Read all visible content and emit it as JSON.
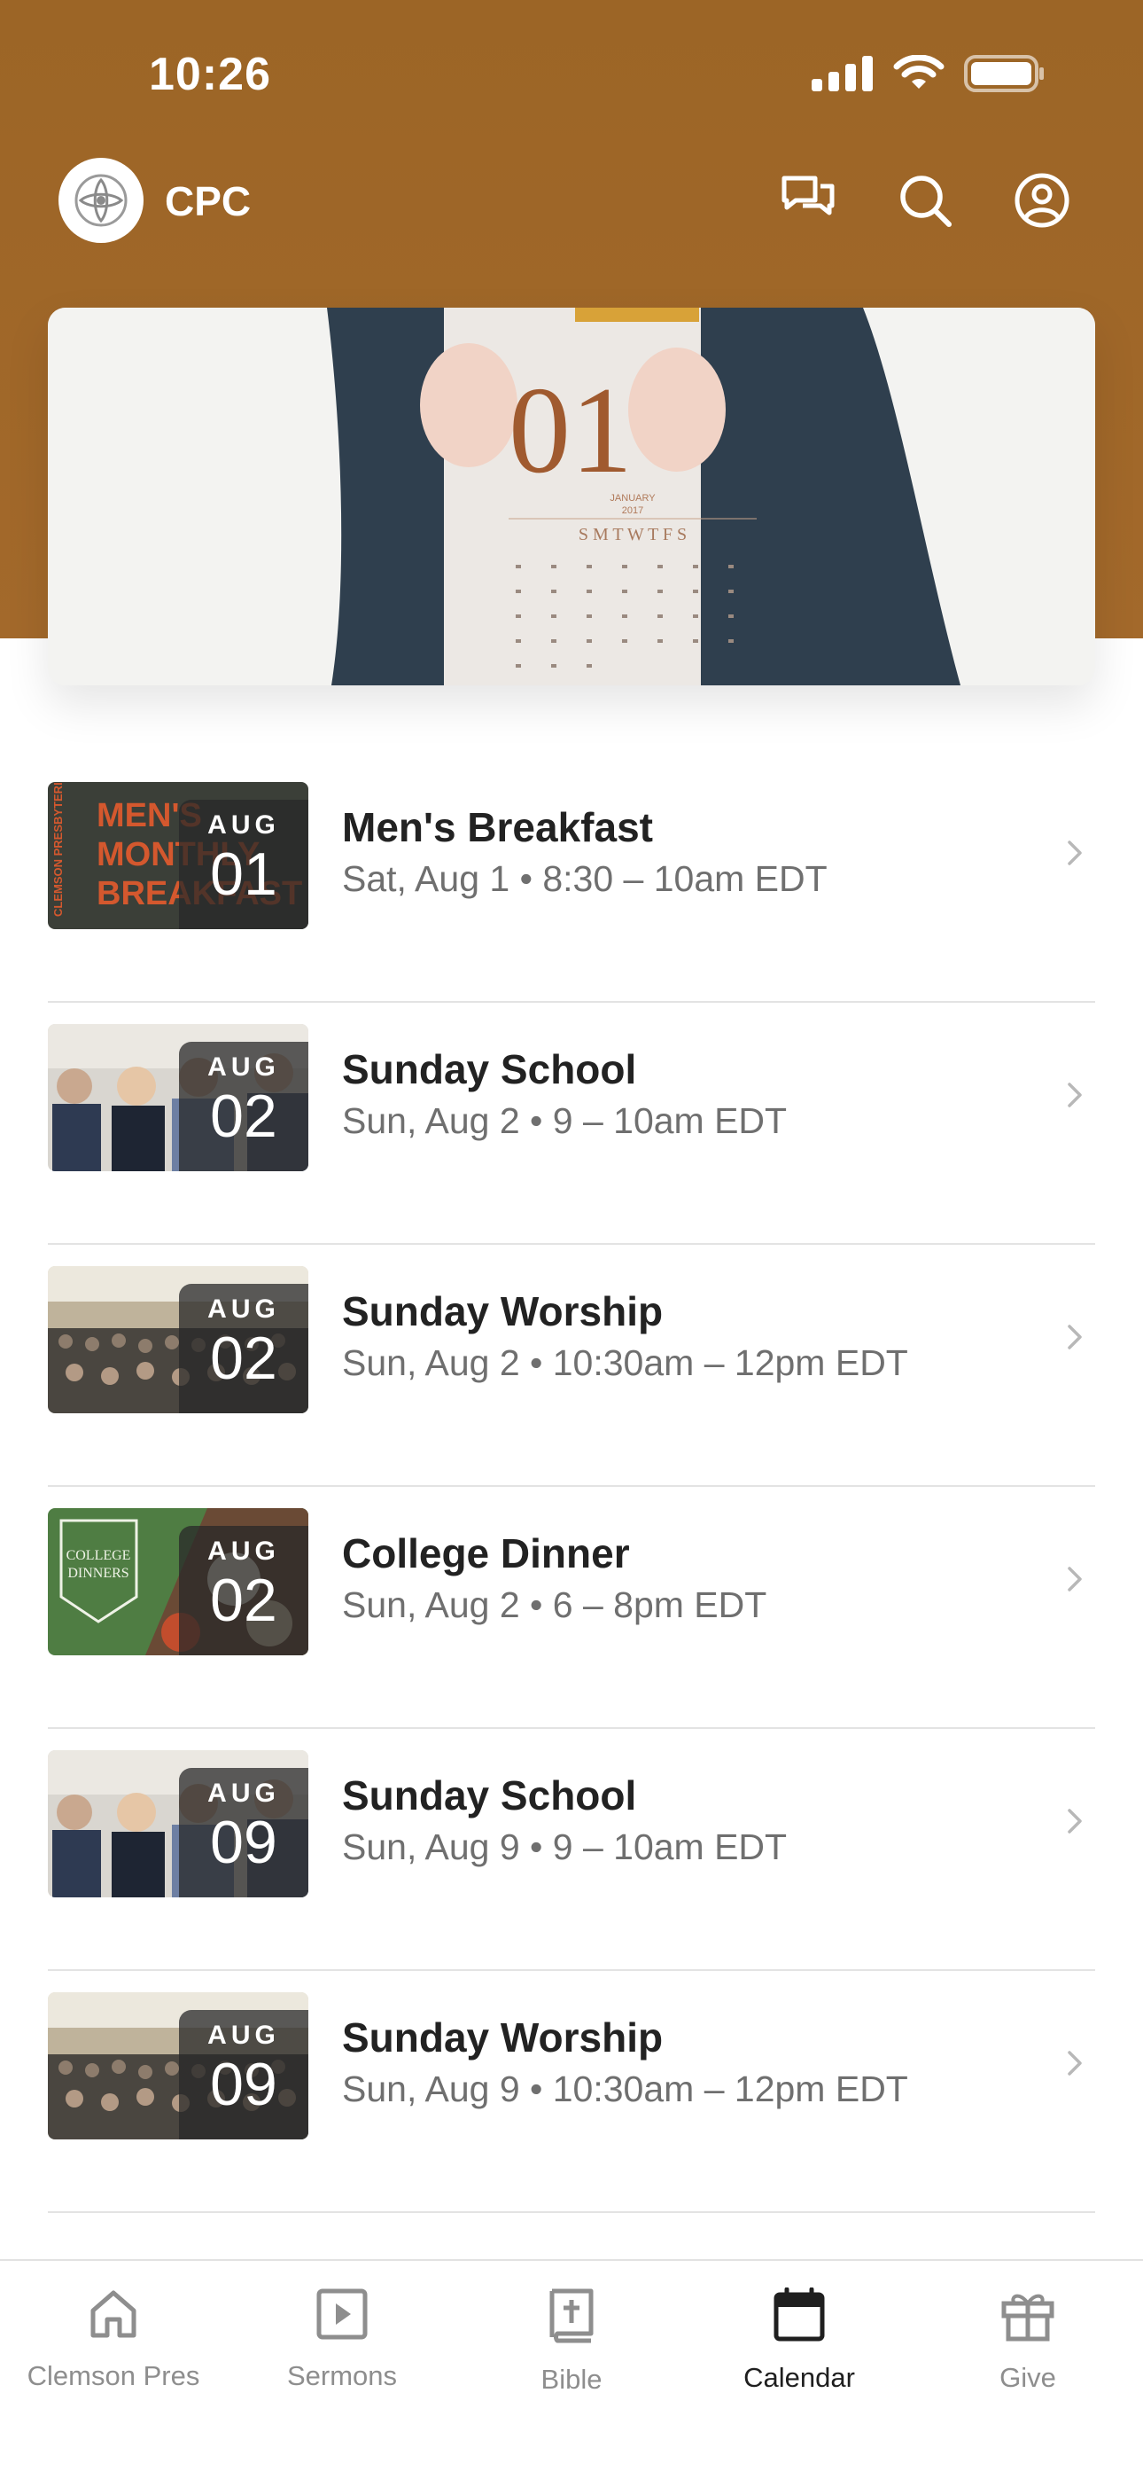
{
  "status_bar": {
    "time": "10:26"
  },
  "header": {
    "app_name": "CPC"
  },
  "hero": {
    "calendar_number": "01",
    "calendar_month": "JANUARY",
    "calendar_year": "2017",
    "weekdays": "S M T W T F S"
  },
  "events": [
    {
      "title": "Men's Breakfast",
      "meta": "Sat, Aug 1 • 8:30 – 10am EDT",
      "month": "AUG",
      "day": "01",
      "thumb": "mens-breakfast-flyer",
      "flyer_text": [
        "MEN'S",
        "MONTHLY",
        "BREAKFAST"
      ],
      "flyer_side": "CLEMSON PRESBYTERIAN"
    },
    {
      "title": "Sunday School",
      "meta": "Sun, Aug 2 • 9 – 10am EDT",
      "month": "AUG",
      "day": "02",
      "thumb": "classroom-photo"
    },
    {
      "title": "Sunday Worship",
      "meta": "Sun, Aug 2 • 10:30am – 12pm EDT",
      "month": "AUG",
      "day": "02",
      "thumb": "sanctuary-photo"
    },
    {
      "title": "College Dinner",
      "meta": "Sun, Aug 2 • 6 – 8pm EDT",
      "month": "AUG",
      "day": "02",
      "thumb": "college-dinner-flyer",
      "flyer_text": [
        "COLLEGE",
        "DINNERS"
      ]
    },
    {
      "title": "Sunday School",
      "meta": "Sun, Aug 9 • 9 – 10am EDT",
      "month": "AUG",
      "day": "09",
      "thumb": "classroom-photo"
    },
    {
      "title": "Sunday Worship",
      "meta": "Sun, Aug 9 • 10:30am – 12pm EDT",
      "month": "AUG",
      "day": "09",
      "thumb": "sanctuary-photo"
    }
  ],
  "tabs": [
    {
      "label": "Clemson Pres",
      "icon": "home-icon",
      "active": false
    },
    {
      "label": "Sermons",
      "icon": "play-icon",
      "active": false
    },
    {
      "label": "Bible",
      "icon": "bible-icon",
      "active": false
    },
    {
      "label": "Calendar",
      "icon": "calendar-icon",
      "active": true
    },
    {
      "label": "Give",
      "icon": "gift-icon",
      "active": false
    }
  ],
  "colors": {
    "brand_brown": "#9c6526",
    "active_tab": "#1f1f1f",
    "inactive_tab": "#8e8e8e"
  }
}
